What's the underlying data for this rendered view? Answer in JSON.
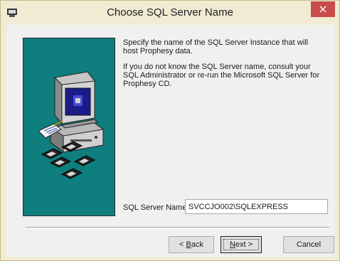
{
  "window": {
    "title": "Choose SQL Server Name",
    "close_glyph": "×"
  },
  "content": {
    "paragraph1": "Specify the name of the SQL Server Instance that will host Prophesy data.",
    "paragraph2": "If you do not know the SQL Server name, consult your SQL Administrator or re-run the Microsoft SQL Server for Prophesy CD."
  },
  "server": {
    "label": "SQL Server Name:",
    "value": "SVCCJO002\\SQLEXPRESS"
  },
  "buttons": {
    "back_prefix": "< ",
    "back_key": "B",
    "back_rest": "ack",
    "next_key": "N",
    "next_rest": "ext >",
    "cancel": "Cancel"
  },
  "colors": {
    "panel": "#0f7e7e",
    "close": "#c94c4c",
    "frame": "#f1ebd4"
  },
  "icons": [
    "installer-icon",
    "close-icon",
    "computer-icon",
    "document-icon",
    "floppy-disk-icon"
  ]
}
